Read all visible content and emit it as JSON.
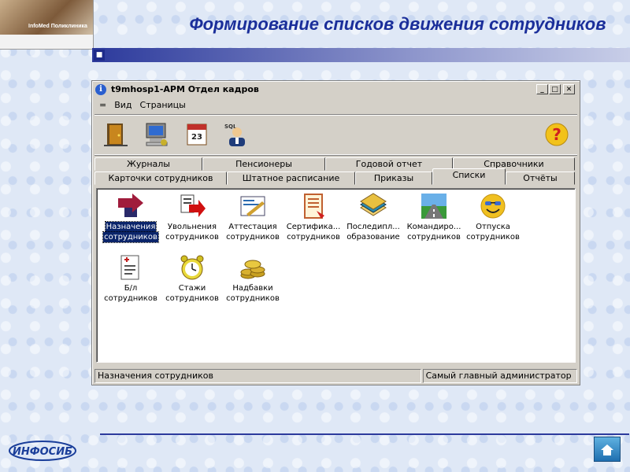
{
  "logo": {
    "brand": "InfoMed Поликлиника"
  },
  "slide": {
    "title": "Формирование списков движения сотрудников"
  },
  "window": {
    "title": "t9mhosp1-АРМ Отдел кадров",
    "info_icon": "i",
    "min_glyph": "_",
    "max_glyph": "□",
    "close_glyph": "✕"
  },
  "menu": [
    "=",
    "Вид",
    "Страницы"
  ],
  "toolbar": [
    {
      "name": "exit-door-icon"
    },
    {
      "name": "computer-icon"
    },
    {
      "name": "calendar-icon",
      "text": "23"
    },
    {
      "name": "sql-user-icon",
      "text": "SQL"
    },
    {
      "name": "help-icon",
      "text": "?"
    }
  ],
  "tabs_row1": [
    "Журналы",
    "Пенсионеры",
    "Годовой отчет",
    "Справочники"
  ],
  "tabs_row2": [
    "Карточки сотрудников",
    "Штатное расписание",
    "Приказы",
    "Списки",
    "Отчёты"
  ],
  "items": [
    {
      "line1": "Назначения",
      "line2": "сотрудников",
      "icon": "arrow-right-icon",
      "color": "#a01c3c"
    },
    {
      "line1": "Увольнения",
      "line2": "сотрудников",
      "icon": "doc-arrow-icon",
      "color": "#d01010"
    },
    {
      "line1": "Аттестация",
      "line2": "сотрудников",
      "icon": "pencil-doc-icon",
      "color": "#d0a030"
    },
    {
      "line1": "Сертифика...",
      "line2": "сотрудников",
      "icon": "certificate-icon",
      "color": "#c06030"
    },
    {
      "line1": "Последипл...",
      "line2": "образование",
      "icon": "books-icon",
      "color": "#2a8ab0"
    },
    {
      "line1": "Командиро...",
      "line2": "сотрудников",
      "icon": "road-icon",
      "color": "#3a9a3a"
    },
    {
      "line1": "Отпуска",
      "line2": "сотрудников",
      "icon": "smiley-sunglasses-icon",
      "color": "#f0c020"
    },
    {
      "line1": "Б/л",
      "line2": "сотрудников",
      "icon": "sick-leave-icon",
      "color": "#c02020"
    },
    {
      "line1": "Стажи",
      "line2": "сотрудников",
      "icon": "alarm-clock-icon",
      "color": "#d0c020"
    },
    {
      "line1": "Надбавки",
      "line2": "сотрудников",
      "icon": "coins-icon",
      "color": "#c8a020"
    }
  ],
  "status": {
    "left": "Назначения сотрудников",
    "right": "Самый главный администратор"
  },
  "footer": {
    "brand": "ИНФОСИБ"
  },
  "colors": {
    "title": "#1a2e9a",
    "selection": "#0a246a",
    "window_bg": "#d4d0c8"
  }
}
